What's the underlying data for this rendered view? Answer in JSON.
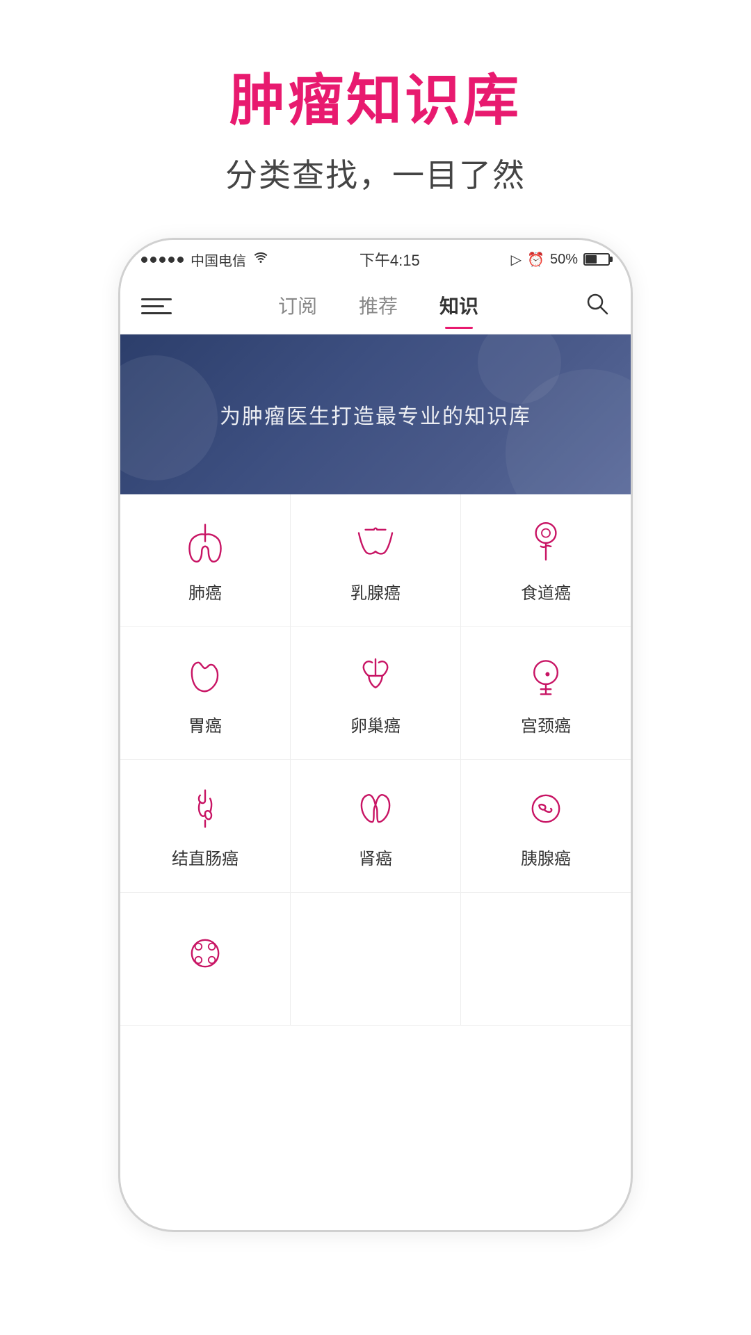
{
  "header": {
    "title": "肿瘤知识库",
    "subtitle": "分类查找，一目了然"
  },
  "statusBar": {
    "carrier": "中国电信",
    "wifi": true,
    "time": "下午4:15",
    "battery": "50%"
  },
  "nav": {
    "tabs": [
      {
        "label": "订阅",
        "active": false
      },
      {
        "label": "推荐",
        "active": false
      },
      {
        "label": "知识",
        "active": true
      }
    ]
  },
  "banner": {
    "text": "为肿瘤医生打造最专业的知识库"
  },
  "cancerTypes": [
    [
      {
        "id": "lung",
        "label": "肺癌",
        "icon": "lung"
      },
      {
        "id": "breast",
        "label": "乳腺癌",
        "icon": "breast"
      },
      {
        "id": "esophagus",
        "label": "食道癌",
        "icon": "esophagus"
      }
    ],
    [
      {
        "id": "stomach",
        "label": "胃癌",
        "icon": "stomach"
      },
      {
        "id": "ovary",
        "label": "卵巢癌",
        "icon": "ovary"
      },
      {
        "id": "cervix",
        "label": "宫颈癌",
        "icon": "cervix"
      }
    ],
    [
      {
        "id": "colon",
        "label": "结直肠癌",
        "icon": "colon"
      },
      {
        "id": "kidney",
        "label": "肾癌",
        "icon": "kidney"
      },
      {
        "id": "pancreas",
        "label": "胰腺癌",
        "icon": "pancreas"
      }
    ],
    [
      {
        "id": "other",
        "label": "",
        "icon": "other"
      }
    ]
  ]
}
